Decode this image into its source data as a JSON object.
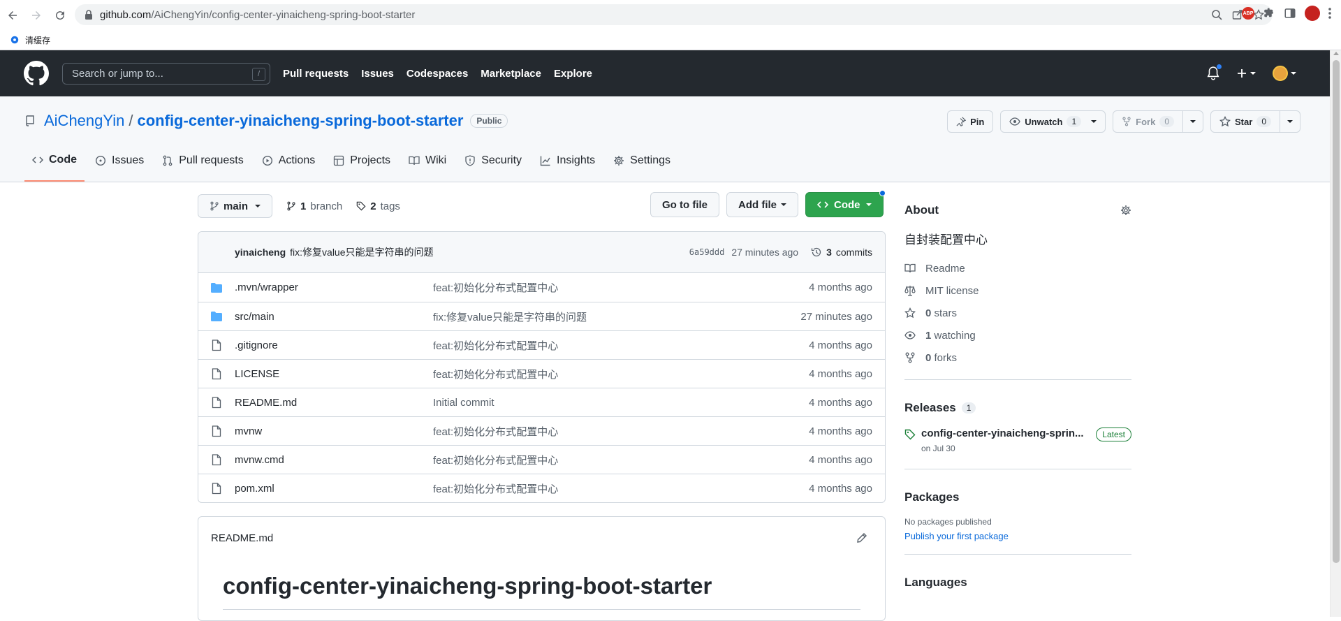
{
  "browser": {
    "url_host": "github.com",
    "url_path": "/AiChengYin/config-center-yinaicheng-spring-boot-starter",
    "bookmark": "清缓存"
  },
  "github": {
    "search_placeholder": "Search or jump to...",
    "search_shortcut": "/",
    "nav": [
      "Pull requests",
      "Issues",
      "Codespaces",
      "Marketplace",
      "Explore"
    ]
  },
  "repo": {
    "owner": "AiChengYin",
    "separator": "/",
    "name": "config-center-yinaicheng-spring-boot-starter",
    "visibility": "Public",
    "pin_label": "Pin",
    "unwatch_label": "Unwatch",
    "watch_count": "1",
    "fork_label": "Fork",
    "fork_count": "0",
    "star_label": "Star",
    "star_count": "0",
    "tabs": [
      "Code",
      "Issues",
      "Pull requests",
      "Actions",
      "Projects",
      "Wiki",
      "Security",
      "Insights",
      "Settings"
    ]
  },
  "filenav": {
    "branch": "main",
    "branch_count": "1",
    "branch_label": "branch",
    "tag_count": "2",
    "tag_label": "tags",
    "go_to_file": "Go to file",
    "add_file": "Add file",
    "code": "Code"
  },
  "commit": {
    "author": "yinaicheng",
    "message": "fix:修复value只能是字符串的问题",
    "sha": "6a59ddd",
    "time": "27 minutes ago",
    "count": "3",
    "count_label": "commits"
  },
  "files": [
    {
      "name": ".mvn/wrapper",
      "type": "dir",
      "message": "feat:初始化分布式配置中心",
      "date": "4 months ago"
    },
    {
      "name": "src/main",
      "type": "dir",
      "message": "fix:修复value只能是字符串的问题",
      "date": "27 minutes ago"
    },
    {
      "name": ".gitignore",
      "type": "file",
      "message": "feat:初始化分布式配置中心",
      "date": "4 months ago"
    },
    {
      "name": "LICENSE",
      "type": "file",
      "message": "feat:初始化分布式配置中心",
      "date": "4 months ago"
    },
    {
      "name": "README.md",
      "type": "file",
      "message": "Initial commit",
      "date": "4 months ago"
    },
    {
      "name": "mvnw",
      "type": "file",
      "message": "feat:初始化分布式配置中心",
      "date": "4 months ago"
    },
    {
      "name": "mvnw.cmd",
      "type": "file",
      "message": "feat:初始化分布式配置中心",
      "date": "4 months ago"
    },
    {
      "name": "pom.xml",
      "type": "file",
      "message": "feat:初始化分布式配置中心",
      "date": "4 months ago"
    }
  ],
  "readme": {
    "filename": "README.md",
    "heading": "config-center-yinaicheng-spring-boot-starter"
  },
  "about": {
    "title": "About",
    "description": "自封装配置中心",
    "readme": "Readme",
    "license": "MIT license",
    "stars_count": "0",
    "stars_label": "stars",
    "watching_count": "1",
    "watching_label": "watching",
    "forks_count": "0",
    "forks_label": "forks"
  },
  "releases": {
    "title": "Releases",
    "count": "1",
    "name": "config-center-yinaicheng-sprin...",
    "badge": "Latest",
    "date": "on Jul 30"
  },
  "packages": {
    "title": "Packages",
    "desc": "No packages published",
    "link": "Publish your first package"
  },
  "languages": {
    "title": "Languages"
  },
  "colors": {
    "header_bg": "#24292f",
    "link": "#0969da",
    "green": "#2da44e",
    "folder": "#54aeff",
    "tab_underline": "#fd8c73"
  }
}
